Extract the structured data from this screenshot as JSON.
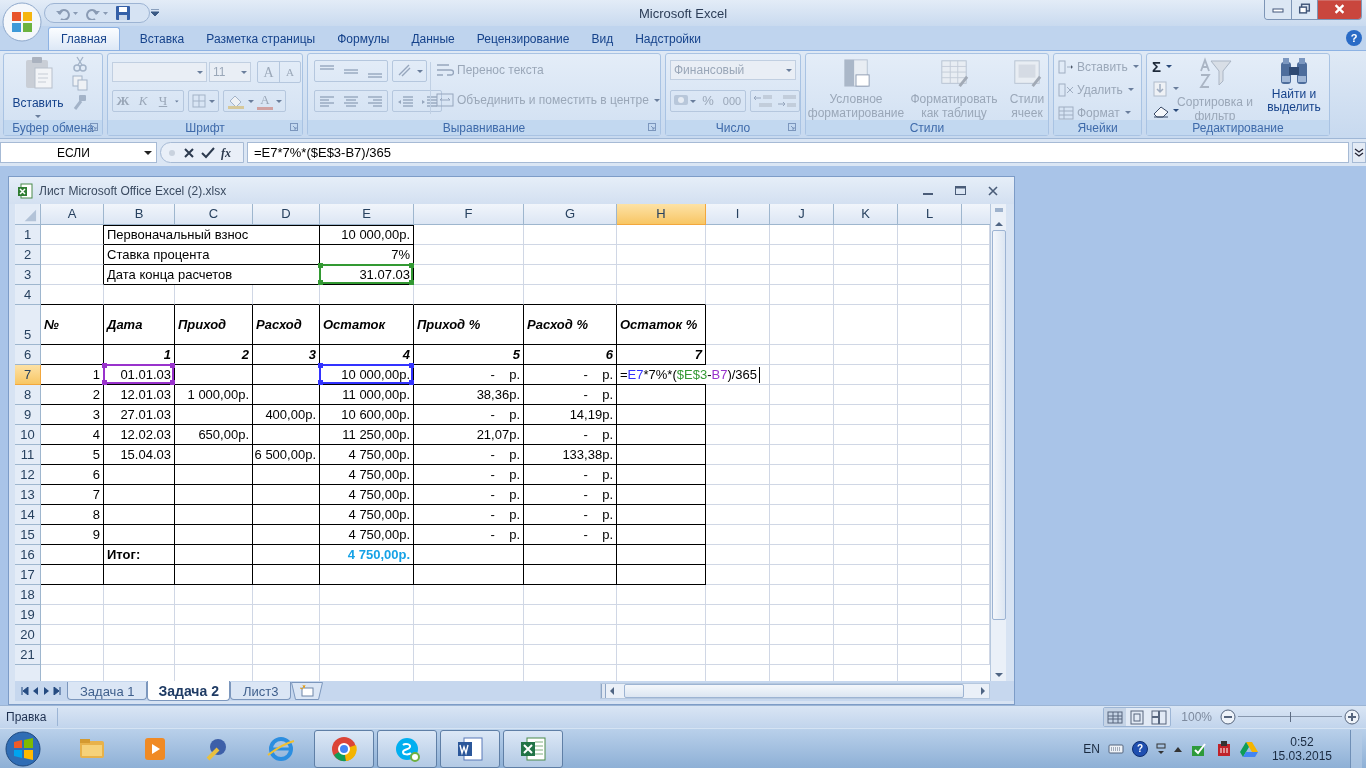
{
  "app_title": "Microsoft Excel",
  "help_button": "?",
  "ribbon_tabs": [
    {
      "label": "Главная",
      "selected": true
    },
    {
      "label": "Вставка",
      "selected": false
    },
    {
      "label": "Разметка страницы",
      "selected": false
    },
    {
      "label": "Формулы",
      "selected": false
    },
    {
      "label": "Данные",
      "selected": false
    },
    {
      "label": "Рецензирование",
      "selected": false
    },
    {
      "label": "Вид",
      "selected": false
    },
    {
      "label": "Надстройки",
      "selected": false
    }
  ],
  "ribbon_groups": [
    {
      "kind": "clipboard",
      "label": "Буфер обмена",
      "paste": "Вставить",
      "disabled": false
    },
    {
      "kind": "font",
      "label": "Шрифт",
      "disabled": true,
      "font_size": "11",
      "grow": "A",
      "shrink": "A",
      "bold": "Ж",
      "italic": "К",
      "underline": "Ч",
      "font_color": "A"
    },
    {
      "kind": "alignment",
      "label": "Выравнивание",
      "disabled": true,
      "wrap": "Перенос текста",
      "merge": "Объединить и поместить в центре"
    },
    {
      "kind": "number",
      "label": "Число",
      "disabled": true,
      "format": "Финансовый",
      "percent": "%",
      "thousands": "000"
    },
    {
      "kind": "styles",
      "label": "Стили",
      "disabled": true,
      "buttons": [
        "Условное форматирование",
        "Форматировать как таблицу",
        "Стили ячеек"
      ]
    },
    {
      "kind": "cells",
      "label": "Ячейки",
      "disabled": true,
      "buttons": [
        "Вставить",
        "Удалить",
        "Формат"
      ]
    },
    {
      "kind": "editing",
      "label": "Редактирование",
      "disabled": false,
      "sum": "Σ",
      "sort": {
        "label": "Сортировка и фильтр",
        "disabled": true
      },
      "find": {
        "label": "Найти и выделить",
        "disabled": false
      }
    }
  ],
  "formula_bar": {
    "name_box": "ЕСЛИ",
    "function_button": "fx",
    "formula": "=E7*7%*($E$3-B7)/365"
  },
  "workbook": {
    "title": "Лист Microsoft Office Excel (2).xlsx",
    "columns": [
      {
        "label": "A",
        "selected": false
      },
      {
        "label": "B",
        "selected": false
      },
      {
        "label": "C",
        "selected": false
      },
      {
        "label": "D",
        "selected": false
      },
      {
        "label": "E",
        "selected": false
      },
      {
        "label": "F",
        "selected": false
      },
      {
        "label": "G",
        "selected": false
      },
      {
        "label": "H",
        "selected": true
      },
      {
        "label": "I",
        "selected": false
      },
      {
        "label": "J",
        "selected": false
      },
      {
        "label": "K",
        "selected": false
      },
      {
        "label": "L",
        "selected": false
      }
    ],
    "rows": [
      {
        "label": "1",
        "kind": "info",
        "selected": false,
        "cells": [
          null,
          "Первоначальный взнос",
          null,
          null,
          "10 000,00р."
        ]
      },
      {
        "label": "2",
        "kind": "info",
        "selected": false,
        "cells": [
          null,
          "Ставка процента",
          null,
          null,
          "7%"
        ]
      },
      {
        "label": "3",
        "kind": "info",
        "selected": false,
        "cells": [
          null,
          "Дата конца расчетов",
          null,
          null,
          {
            "text": "31.07.03",
            "color": "#339933"
          }
        ]
      },
      {
        "label": "4",
        "kind": "blank",
        "selected": false,
        "cells": []
      },
      {
        "label": "5",
        "kind": "header",
        "selected": false,
        "cells": [
          "№",
          "Дата",
          "Приход",
          "Расход",
          "Остаток",
          "Приход %",
          "Расход %",
          "Остаток %"
        ]
      },
      {
        "label": "6",
        "kind": "index",
        "selected": false,
        "cells": [
          null,
          "1",
          "2",
          "3",
          "4",
          "5",
          "6",
          "7"
        ]
      },
      {
        "label": "7",
        "kind": "data",
        "selected": true,
        "cells": [
          "1",
          {
            "text": "01.01.03",
            "color": "#9933cc"
          },
          null,
          null,
          {
            "text": "10 000,00р.",
            "color": "#3333ff"
          },
          "-    р.",
          "-    р.",
          {
            "segments": [
              {
                "text": "="
              },
              {
                "text": "E7",
                "color": "#3333ff"
              },
              {
                "text": "*7%*("
              },
              {
                "text": "$E$3",
                "color": "#339933"
              },
              {
                "text": "-"
              },
              {
                "text": "B7",
                "color": "#9933cc"
              },
              {
                "text": ")/365"
              }
            ]
          }
        ]
      },
      {
        "label": "8",
        "kind": "data",
        "selected": false,
        "cells": [
          "2",
          "12.01.03",
          "1 000,00р.",
          null,
          "11 000,00р.",
          "38,36р.",
          "-    р."
        ]
      },
      {
        "label": "9",
        "kind": "data",
        "selected": false,
        "cells": [
          "3",
          "27.01.03",
          null,
          "400,00р.",
          "10 600,00р.",
          "-    р.",
          "14,19р."
        ]
      },
      {
        "label": "10",
        "kind": "data",
        "selected": false,
        "cells": [
          "4",
          "12.02.03",
          "650,00р.",
          null,
          "11 250,00р.",
          "21,07р.",
          "-    р."
        ]
      },
      {
        "label": "11",
        "kind": "data",
        "selected": false,
        "cells": [
          "5",
          "15.04.03",
          null,
          "6 500,00р.",
          "4 750,00р.",
          "-    р.",
          "133,38р."
        ]
      },
      {
        "label": "12",
        "kind": "data",
        "selected": false,
        "cells": [
          "6",
          null,
          null,
          null,
          "4 750,00р.",
          "-    р.",
          "-    р."
        ]
      },
      {
        "label": "13",
        "kind": "data",
        "selected": false,
        "cells": [
          "7",
          null,
          null,
          null,
          "4 750,00р.",
          "-    р.",
          "-    р."
        ]
      },
      {
        "label": "14",
        "kind": "data",
        "selected": false,
        "cells": [
          "8",
          null,
          null,
          null,
          "4 750,00р.",
          "-    р.",
          "-    р."
        ]
      },
      {
        "label": "15",
        "kind": "data",
        "selected": false,
        "cells": [
          "9",
          null,
          null,
          null,
          "4 750,00р.",
          "-    р.",
          "-    р."
        ]
      },
      {
        "label": "16",
        "kind": "total",
        "selected": false,
        "cells": [
          null,
          "Итог:",
          null,
          null,
          "4 750,00р."
        ]
      },
      {
        "label": "17",
        "kind": "empty",
        "selected": false,
        "cells": []
      },
      {
        "label": "18",
        "kind": "plain",
        "selected": false,
        "cells": []
      },
      {
        "label": "19",
        "kind": "plain",
        "selected": false,
        "cells": []
      },
      {
        "label": "20",
        "kind": "plain",
        "selected": false,
        "cells": []
      },
      {
        "label": "21",
        "kind": "plain",
        "selected": false,
        "cells": []
      }
    ],
    "sheets": [
      {
        "label": "Задача 1",
        "selected": false
      },
      {
        "label": "Задача 2",
        "selected": true
      },
      {
        "label": "Лист3",
        "selected": false
      }
    ]
  },
  "status_bar": {
    "mode": "Правка",
    "views": [
      {
        "kind": "normal",
        "selected": true
      },
      {
        "kind": "layout",
        "selected": false
      },
      {
        "kind": "pagebreak",
        "selected": false
      }
    ],
    "zoom": {
      "reading": "100%",
      "level": 0.5
    }
  },
  "taskbar": {
    "apps": [
      {
        "kind": "folder",
        "running": false
      },
      {
        "kind": "player",
        "running": false
      },
      {
        "kind": "tool",
        "running": false
      },
      {
        "kind": "ie",
        "running": false
      },
      {
        "kind": "chrome",
        "running": true
      },
      {
        "kind": "skype",
        "running": true
      },
      {
        "kind": "word",
        "running": true
      },
      {
        "kind": "excel",
        "running": true
      }
    ],
    "language": "EN",
    "help": "?",
    "time": "0:52",
    "date": "15.03.2015"
  }
}
